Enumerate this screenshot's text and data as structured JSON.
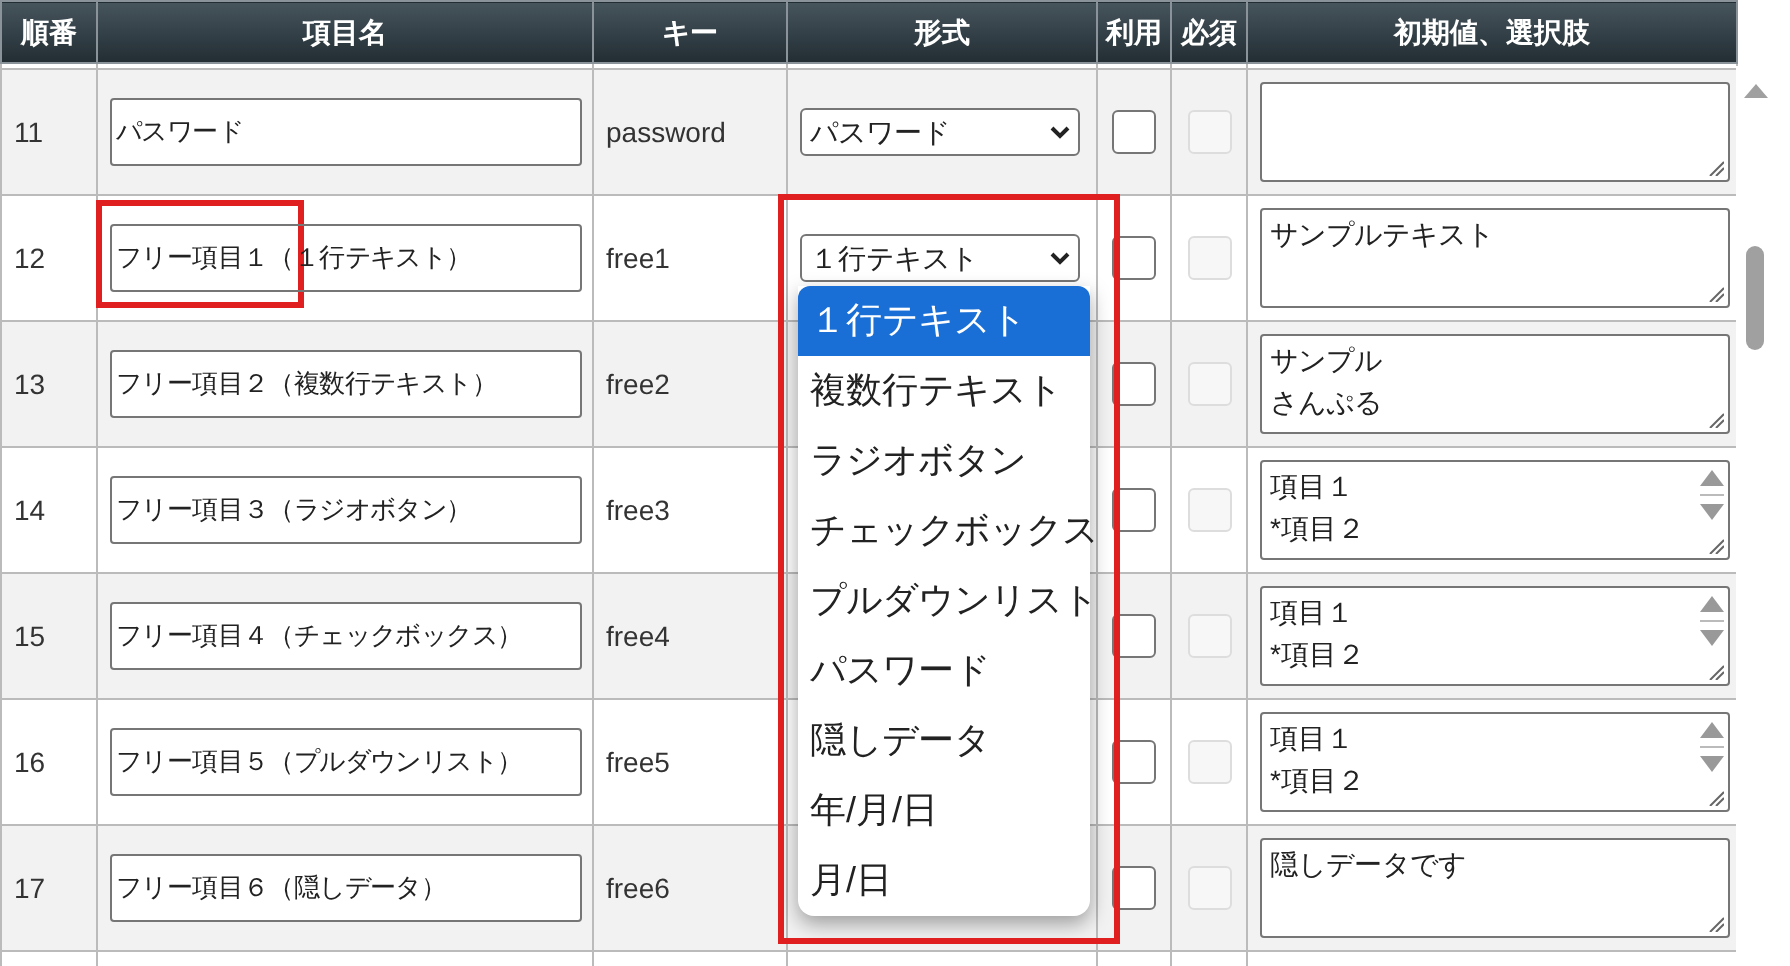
{
  "columns": [
    "順番",
    "項目名",
    "キー",
    "形式",
    "利用",
    "必須",
    "初期値、選択肢"
  ],
  "rows": [
    {
      "number": "11",
      "name": "パスワード",
      "name_highlighted": false,
      "key": "password",
      "type": "パスワード",
      "use": {
        "checked": false
      },
      "required": {
        "checked": false,
        "disabled": true
      },
      "scrollable": false
    },
    {
      "number": "12",
      "name": "フリー項目１（１行テキスト）",
      "name_highlighted": true,
      "key": "free1",
      "type": "１行テキスト",
      "use": {
        "checked": false
      },
      "required": {
        "checked": false,
        "disabled": true
      },
      "default": [
        "サンプルテキスト"
      ],
      "scrollable": false
    },
    {
      "number": "13",
      "name": "フリー項目２（複数行テキスト）",
      "name_highlighted": false,
      "key": "free2",
      "use": {
        "checked": false
      },
      "required": {
        "checked": false,
        "disabled": true
      },
      "default": [
        "サンプル",
        "さんぷる"
      ],
      "scrollable": false
    },
    {
      "number": "14",
      "name": "フリー項目３（ラジオボタン）",
      "name_highlighted": false,
      "key": "free3",
      "use": {
        "checked": false
      },
      "required": {
        "checked": false,
        "disabled": true
      },
      "default": [
        "項目１",
        "*項目２"
      ],
      "scrollable": true
    },
    {
      "number": "15",
      "name": "フリー項目４（チェックボックス）",
      "name_highlighted": false,
      "key": "free4",
      "use": {
        "checked": false
      },
      "required": {
        "checked": false,
        "disabled": true
      },
      "default": [
        "項目１",
        "*項目２"
      ],
      "scrollable": true
    },
    {
      "number": "16",
      "name": "フリー項目５（プルダウンリスト）",
      "name_highlighted": false,
      "key": "free5",
      "use": {
        "checked": false
      },
      "required": {
        "checked": false,
        "disabled": true
      },
      "default": [
        "項目１",
        "*項目２"
      ],
      "scrollable": true
    },
    {
      "number": "17",
      "name": "フリー項目６（隠しデータ）",
      "name_highlighted": false,
      "key": "free6",
      "use": {
        "checked": false
      },
      "required": {
        "checked": false,
        "disabled": true
      },
      "default": [
        "隠しデータです"
      ],
      "scrollable": false
    }
  ],
  "type_menu": {
    "highlighted": true,
    "options": [
      {
        "label": "１行テキスト",
        "selected": true
      },
      {
        "label": "複数行テキスト",
        "selected": false
      },
      {
        "label": "ラジオボタン",
        "selected": false
      },
      {
        "label": "チェックボックス",
        "selected": false
      },
      {
        "label": "プルダウンリスト",
        "selected": false
      },
      {
        "label": "パスワード",
        "selected": false
      },
      {
        "label": "隠しデータ",
        "selected": false
      },
      {
        "label": "年/月/日",
        "selected": false
      },
      {
        "label": "月/日",
        "selected": false
      }
    ]
  }
}
